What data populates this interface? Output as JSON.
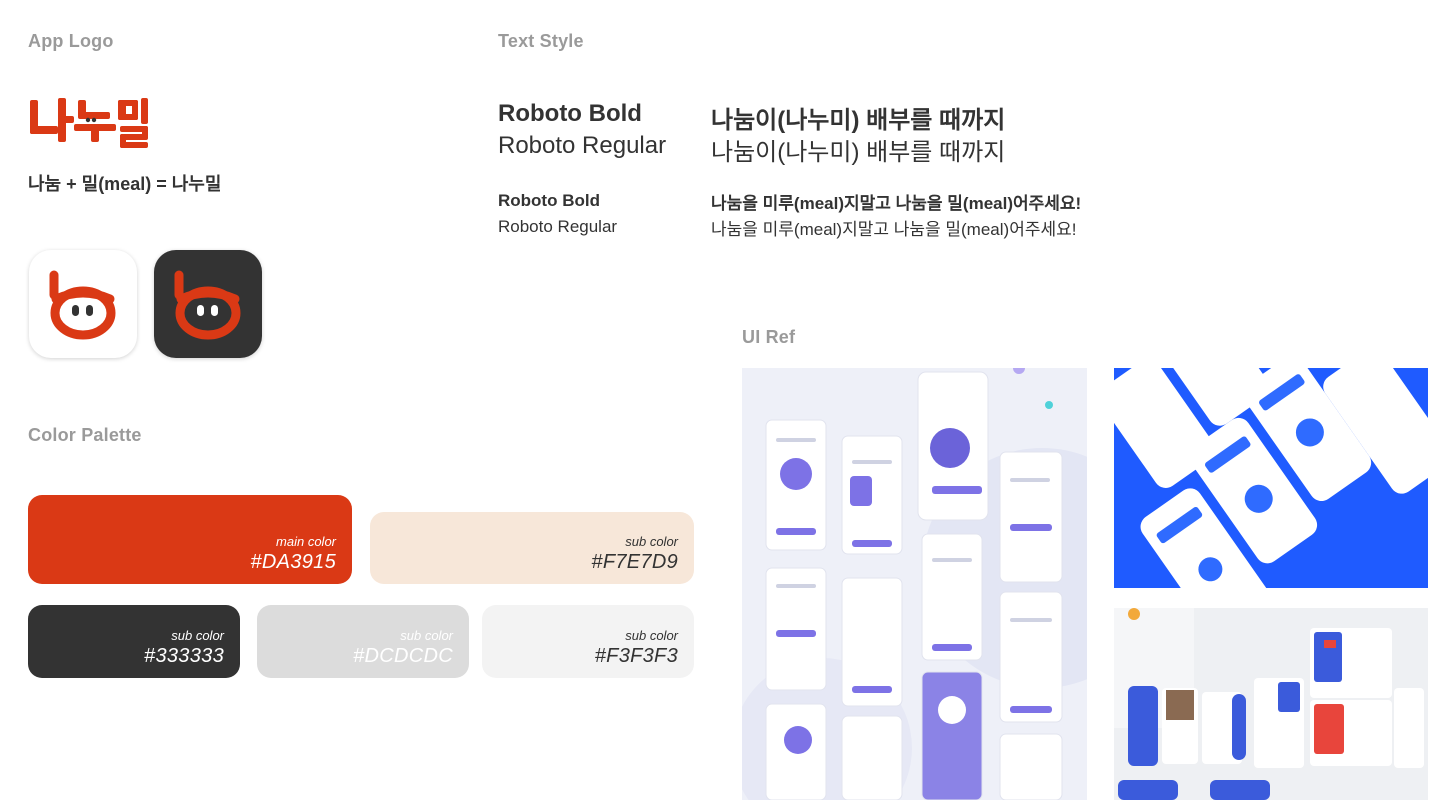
{
  "sections": {
    "app_logo": "App Logo",
    "text_style": "Text Style",
    "color_palette": "Color Palette",
    "ui_ref": "UI Ref"
  },
  "logo": {
    "wordmark": "나누밀",
    "formula": "나눔 + 밀(meal) = 나누밀",
    "icon_light": "app-icon-light",
    "icon_dark": "app-icon-dark"
  },
  "text_style": {
    "large_bold": "Roboto Bold",
    "large_regular": "Roboto Regular",
    "small_bold": "Roboto Bold",
    "small_regular": "Roboto  Regular",
    "ko_large_bold": "나눔이(나누미) 배부를 때까지",
    "ko_large_regular": "나눔이(나누미) 배부를 때까지",
    "ko_small_bold": "나눔을 미루(meal)지말고 나눔을 밀(meal)어주세요!",
    "ko_small_regular": "나눔을 미루(meal)지말고 나눔을 밀(meal)어주세요!"
  },
  "palette": [
    {
      "label": "main color",
      "hex": "#DA3915",
      "color": "#DA3915",
      "text_color": "#ffffff"
    },
    {
      "label": "sub color",
      "hex": "#F7E7D9",
      "color": "#F7E7D9",
      "text_color": "#333333"
    },
    {
      "label": "sub color",
      "hex": "#333333",
      "color": "#333333",
      "text_color": "#ffffff"
    },
    {
      "label": "sub color",
      "hex": "#DCDCDC",
      "color": "#DCDCDC",
      "text_color": "#ffffff"
    },
    {
      "label": "sub color",
      "hex": "#F3F3F3",
      "color": "#F3F3F3",
      "text_color": "#333333"
    }
  ],
  "ui_ref": {
    "images": [
      "onboarding-screens",
      "blue-phone-mockups",
      "article-cards-mockup"
    ]
  }
}
